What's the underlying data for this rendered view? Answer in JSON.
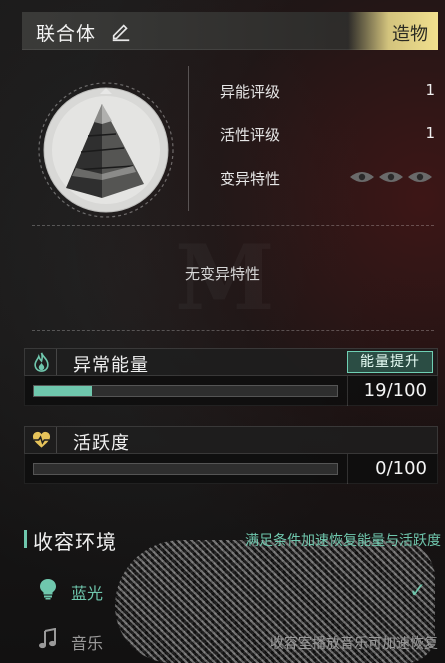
{
  "header": {
    "title": "联合体",
    "tag": "造物"
  },
  "emblem": {
    "icon": "pyramid-icon"
  },
  "stats": [
    {
      "label": "异能评级",
      "value": "1"
    },
    {
      "label": "活性评级",
      "value": "1"
    },
    {
      "label": "变异特性",
      "icons": [
        "eye-icon",
        "eye-icon",
        "eye-icon"
      ]
    }
  ],
  "traits": {
    "empty_text": "无变异特性"
  },
  "meters": {
    "anomaly": {
      "title": "异常能量",
      "icon": "flame-icon",
      "button": "能量提升",
      "value_text": "19/100",
      "fill": 0.19,
      "fill_color": "#6fc7ad"
    },
    "activity": {
      "title": "活跃度",
      "icon": "heart-pulse-icon",
      "value_text": "0/100",
      "fill": 0.0
    }
  },
  "environment": {
    "title": "收容环境",
    "hint": "满足条件加速恢复能量与活跃度",
    "items": [
      {
        "label": "蓝光",
        "icon": "lightbulb-icon",
        "color": "#6fc7ad",
        "status": "✓"
      },
      {
        "label": "音乐",
        "icon": "music-note-icon",
        "color": "#9a9a9a",
        "hint": "收容室播放音乐可加速恢复"
      }
    ]
  },
  "colors": {
    "accent": "#6fc7ad",
    "tag_gold": "#f1e08e"
  }
}
